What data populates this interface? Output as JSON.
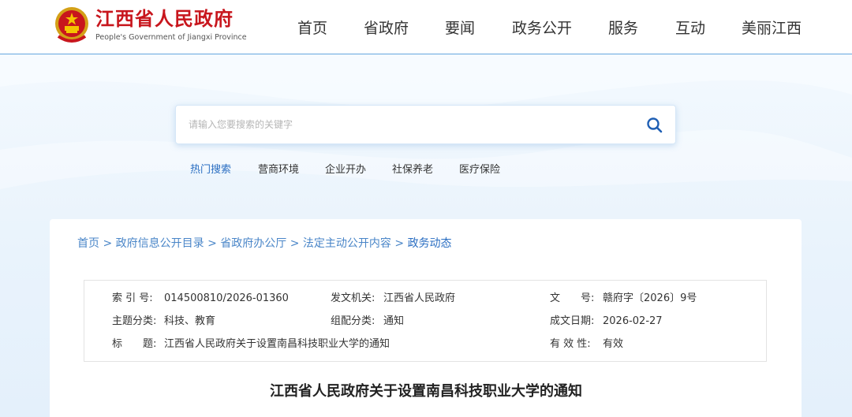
{
  "header": {
    "logo_cn": "江西省人民政府",
    "logo_en": "People's Government of Jiangxi Province",
    "nav": [
      "首页",
      "省政府",
      "要闻",
      "政务公开",
      "服务",
      "互动",
      "美丽江西"
    ]
  },
  "search": {
    "placeholder": "请输入您要搜索的关键字",
    "hot_title": "热门搜索",
    "hot_items": [
      "营商环境",
      "企业开办",
      "社保养老",
      "医疗保险"
    ]
  },
  "breadcrumb": {
    "items": [
      "首页",
      "政府信息公开目录",
      "省政府办公厅",
      "法定主动公开内容"
    ],
    "current": "政务动态",
    "separator": ">"
  },
  "meta": {
    "index_label": "索 引 号:",
    "index_value": "014500810/2026-01360",
    "issuer_label": "发文机关:",
    "issuer_value": "江西省人民政府",
    "docno_label": "文　　号:",
    "docno_value": "赣府字〔2026〕9号",
    "topic_label": "主题分类:",
    "topic_value": "科技、教育",
    "org_label": "组配分类:",
    "org_value": "通知",
    "date_label": "成文日期:",
    "date_value": "2026-02-27",
    "title_label": "标　　题:",
    "title_value": "江西省人民政府关于设置南昌科技职业大学的通知",
    "validity_label": "有 效 性:",
    "validity_value": "有效"
  },
  "document": {
    "title": "江西省人民政府关于设置南昌科技职业大学的通知"
  },
  "colors": {
    "brand_red": "#c8161d",
    "link_blue": "#2a6ec2",
    "banner_bg": "#eef6fd"
  }
}
